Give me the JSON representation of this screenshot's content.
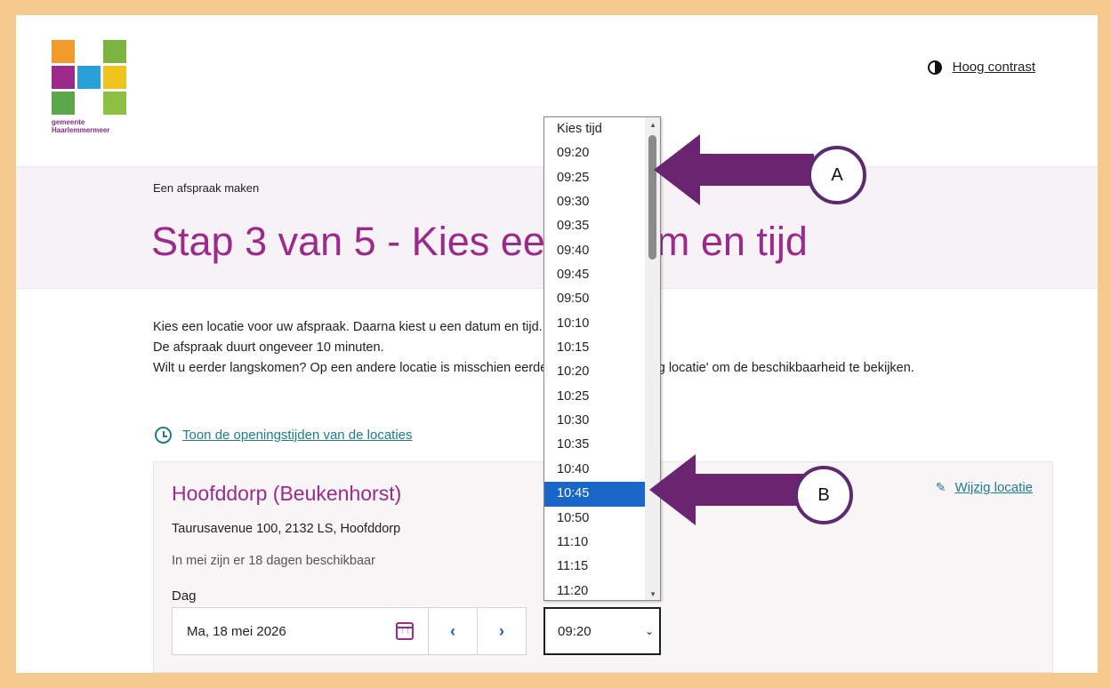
{
  "header": {
    "logo_text": "gemeente Haarlemmermeer",
    "contrast_label": "Hoog contrast"
  },
  "band": {
    "breadcrumb": "Een afspraak maken",
    "title": "Stap 3 van 5 - Kies een datum en tijd"
  },
  "intro": {
    "line1": "Kies een locatie voor uw afspraak. Daarna kiest u een datum en tijd.",
    "line2": "De afspraak duurt ongeveer 10 minuten.",
    "line3": "Wilt u eerder langskomen? Op een andere locatie is misschien eerder plek. Klik op 'Wijzig locatie' om de beschikbaarheid te bekijken."
  },
  "hours_link": "Toon de openingstijden van de locaties",
  "location": {
    "name": "Hoofddorp (Beukenhorst)",
    "address": "Taurusavenue 100, 2132 LS, Hoofddorp",
    "availability": "In mei zijn er 18 dagen beschikbaar",
    "change_label": "Wijzig locatie",
    "day_label": "Dag",
    "date_value": "Ma, 18 mei 2026",
    "time_value": "09:20"
  },
  "nav": {
    "prev": "‹",
    "next": "›"
  },
  "dropdown": {
    "options": [
      "Kies tijd",
      "09:20",
      "09:25",
      "09:30",
      "09:35",
      "09:40",
      "09:45",
      "09:50",
      "10:10",
      "10:15",
      "10:20",
      "10:25",
      "10:30",
      "10:35",
      "10:40",
      "10:45",
      "10:50",
      "11:10",
      "11:15",
      "11:20"
    ],
    "selected": "10:45"
  },
  "annotations": {
    "a": "A",
    "b": "B",
    "arrow_color": "#6b2470"
  },
  "colors": {
    "brand": "#9b2a8c",
    "link": "#1d7d8c",
    "select_highlight": "#1a66c8",
    "frame": "#f6c98e"
  }
}
